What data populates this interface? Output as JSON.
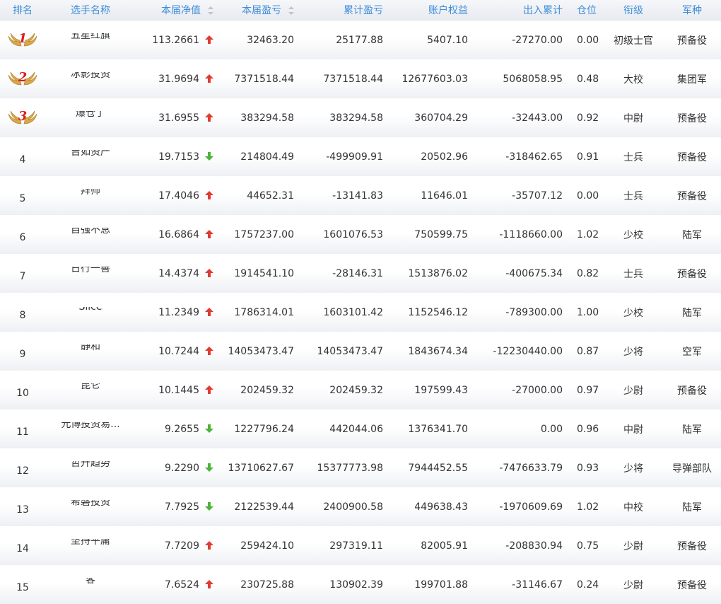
{
  "headers": {
    "rank": "排名",
    "name": "选手名称",
    "nav": "本届净值",
    "cur_pl": "本届盈亏",
    "cum_pl": "累计盈亏",
    "equity": "账户权益",
    "flow": "出入累计",
    "position": "仓位",
    "military_rank": "衔级",
    "branch": "军种"
  },
  "colors": {
    "header_text": "#3f8ed8",
    "up": "#e03b2f",
    "down": "#4db336",
    "medal": "#d9a848",
    "medal_num": "#d62222"
  },
  "rows": [
    {
      "rank": "1",
      "name": "五星红旗",
      "nav": "113.2661",
      "trend": "up",
      "cur_pl": "32463.20",
      "cum_pl": "25177.88",
      "equity": "5407.10",
      "flow": "-27270.00",
      "position": "0.00",
      "military_rank": "初级士官",
      "branch": "预备役"
    },
    {
      "rank": "2",
      "name": "冰影投资",
      "nav": "31.9694",
      "trend": "up",
      "cur_pl": "7371518.44",
      "cum_pl": "7371518.44",
      "equity": "12677603.03",
      "flow": "5068058.95",
      "position": "0.48",
      "military_rank": "大校",
      "branch": "集团军"
    },
    {
      "rank": "3",
      "name": "爆仓了",
      "nav": "31.6955",
      "trend": "up",
      "cur_pl": "383294.58",
      "cum_pl": "383294.58",
      "equity": "360704.29",
      "flow": "-32443.00",
      "position": "0.92",
      "military_rank": "中尉",
      "branch": "预备役"
    },
    {
      "rank": "4",
      "name": "吉如资产",
      "nav": "19.7153",
      "trend": "down",
      "cur_pl": "214804.49",
      "cum_pl": "-499909.91",
      "equity": "20502.96",
      "flow": "-318462.65",
      "position": "0.91",
      "military_rank": "士兵",
      "branch": "预备役"
    },
    {
      "rank": "5",
      "name": "拜师",
      "nav": "17.4046",
      "trend": "up",
      "cur_pl": "44652.31",
      "cum_pl": "-13141.83",
      "equity": "11646.01",
      "flow": "-35707.12",
      "position": "0.00",
      "military_rank": "士兵",
      "branch": "预备役"
    },
    {
      "rank": "6",
      "name": "自强不息",
      "nav": "16.6864",
      "trend": "up",
      "cur_pl": "1757237.00",
      "cum_pl": "1601076.53",
      "equity": "750599.75",
      "flow": "-1118660.00",
      "position": "1.02",
      "military_rank": "少校",
      "branch": "陆军"
    },
    {
      "rank": "7",
      "name": "日行一善",
      "nav": "14.4374",
      "trend": "up",
      "cur_pl": "1914541.10",
      "cum_pl": "-28146.31",
      "equity": "1513876.02",
      "flow": "-400675.34",
      "position": "0.82",
      "military_rank": "士兵",
      "branch": "预备役"
    },
    {
      "rank": "8",
      "name": "Slice",
      "nav": "11.2349",
      "trend": "up",
      "cur_pl": "1786314.01",
      "cum_pl": "1603101.42",
      "equity": "1152546.12",
      "flow": "-789300.00",
      "position": "1.00",
      "military_rank": "少校",
      "branch": "陆军"
    },
    {
      "rank": "9",
      "name": "静和",
      "nav": "10.7244",
      "trend": "up",
      "cur_pl": "14053473.47",
      "cum_pl": "14053473.47",
      "equity": "1843674.34",
      "flow": "-12230440.00",
      "position": "0.87",
      "military_rank": "少将",
      "branch": "空军"
    },
    {
      "rank": "10",
      "name": "昆仑",
      "nav": "10.1445",
      "trend": "up",
      "cur_pl": "202459.32",
      "cum_pl": "202459.32",
      "equity": "197599.43",
      "flow": "-27000.00",
      "position": "0.97",
      "military_rank": "少尉",
      "branch": "预备役"
    },
    {
      "rank": "11",
      "name": "元博投资易...",
      "nav": "9.2655",
      "trend": "down",
      "cur_pl": "1227796.24",
      "cum_pl": "442044.06",
      "equity": "1376341.70",
      "flow": "0.00",
      "position": "0.96",
      "military_rank": "中尉",
      "branch": "陆军"
    },
    {
      "rank": "12",
      "name": "哲升趋势",
      "nav": "9.2290",
      "trend": "down",
      "cur_pl": "13710627.67",
      "cum_pl": "15377773.98",
      "equity": "7944452.55",
      "flow": "-7476633.79",
      "position": "0.93",
      "military_rank": "少将",
      "branch": "导弹部队"
    },
    {
      "rank": "13",
      "name": "希磐投资",
      "nav": "7.7925",
      "trend": "down",
      "cur_pl": "2122539.44",
      "cum_pl": "2400900.58",
      "equity": "449638.43",
      "flow": "-1970609.69",
      "position": "1.02",
      "military_rank": "中校",
      "branch": "陆军"
    },
    {
      "rank": "14",
      "name": "坚持平庸",
      "nav": "7.7209",
      "trend": "up",
      "cur_pl": "259424.10",
      "cum_pl": "297319.11",
      "equity": "82005.91",
      "flow": "-208830.94",
      "position": "0.75",
      "military_rank": "少尉",
      "branch": "预备役"
    },
    {
      "rank": "15",
      "name": "客",
      "nav": "7.6524",
      "trend": "up",
      "cur_pl": "230725.88",
      "cum_pl": "130902.39",
      "equity": "199701.88",
      "flow": "-31146.67",
      "position": "0.24",
      "military_rank": "少尉",
      "branch": "预备役"
    }
  ]
}
